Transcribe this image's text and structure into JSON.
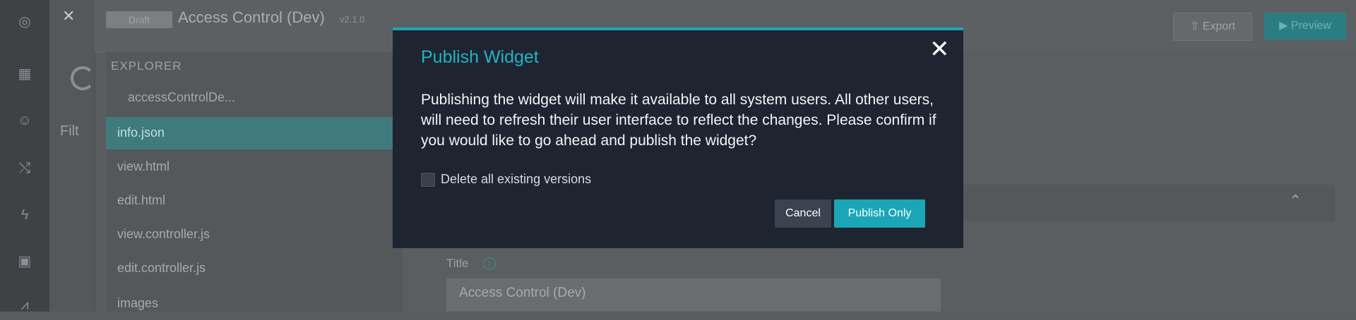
{
  "app": {
    "status_badge": "Draft",
    "title": "Access Control (Dev)",
    "version": "v2.1.0",
    "export_label": "Export",
    "preview_label": "Preview",
    "filter_label": "Filt"
  },
  "explorer": {
    "title": "EXPLORER",
    "folder": "accessControlDe...",
    "files": [
      {
        "name": "info.json",
        "active": true
      },
      {
        "name": "view.html",
        "active": false
      },
      {
        "name": "edit.html",
        "active": false
      },
      {
        "name": "view.controller.js",
        "active": false
      },
      {
        "name": "edit.controller.js",
        "active": false
      },
      {
        "name": "images",
        "active": false
      }
    ]
  },
  "form": {
    "title_label": "Title",
    "title_value": "Access Control (Dev)"
  },
  "modal": {
    "title": "Publish Widget",
    "body": "Publishing the widget will make it available to all system users. All other users, will need to refresh their user interface to reflect the changes. Please confirm if you would like to go ahead and publish the widget?",
    "checkbox_label": "Delete all existing versions",
    "checkbox_checked": false,
    "cancel_label": "Cancel",
    "publish_label": "Publish Only"
  },
  "colors": {
    "accent": "#1aa6b7",
    "modal_bg": "#1e2430"
  }
}
